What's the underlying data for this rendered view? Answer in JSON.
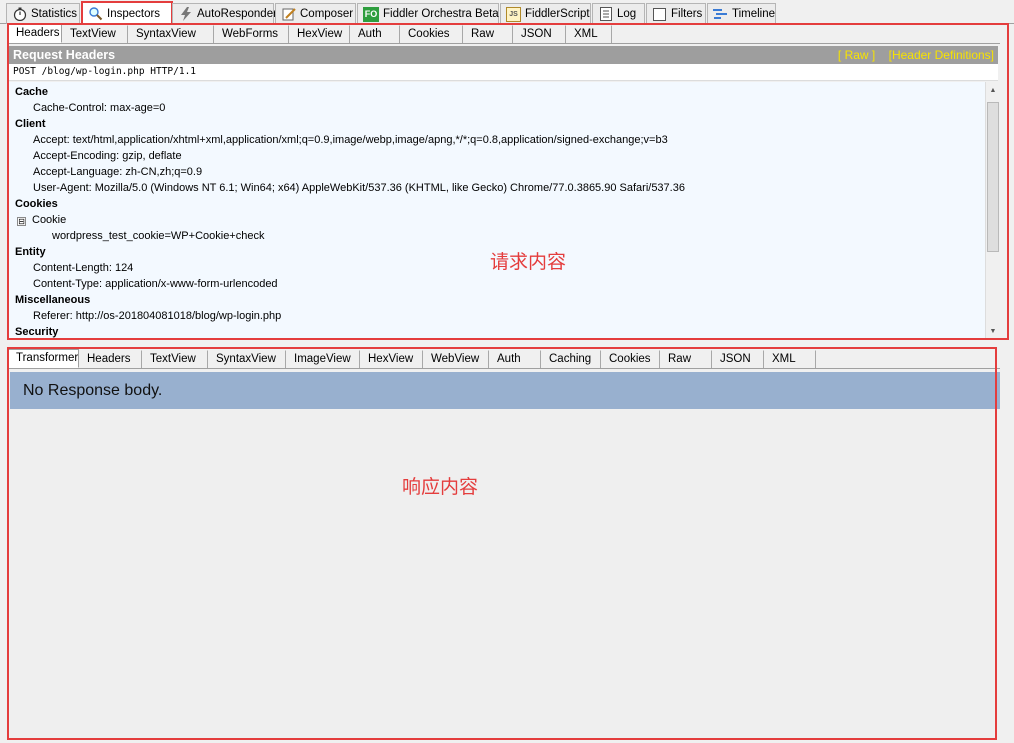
{
  "top_tabs": [
    {
      "label": "Statistics",
      "icon": "stopwatch-icon"
    },
    {
      "label": "Inspectors",
      "icon": "magnifier-icon",
      "active": true
    },
    {
      "label": "AutoResponder",
      "icon": "lightning-icon"
    },
    {
      "label": "Composer",
      "icon": "pencil-icon"
    },
    {
      "label": "Fiddler Orchestra Beta",
      "icon": "fo-icon",
      "icon_text": "FO"
    },
    {
      "label": "FiddlerScript",
      "icon": "script-icon",
      "icon_text": "JS"
    },
    {
      "label": "Log",
      "icon": "log-icon"
    },
    {
      "label": "Filters",
      "icon": "checkbox-icon"
    },
    {
      "label": "Timeline",
      "icon": "timeline-icon"
    }
  ],
  "request": {
    "tabs": [
      "Headers",
      "TextView",
      "SyntaxView",
      "WebForms",
      "HexView",
      "Auth",
      "Cookies",
      "Raw",
      "JSON",
      "XML"
    ],
    "title": "Request Headers",
    "raw_link": "[ Raw ]",
    "defs_link": "[Header Definitions]",
    "request_line": "POST /blog/wp-login.php HTTP/1.1",
    "tree": [
      {
        "group": "Cache",
        "items": [
          "Cache-Control: max-age=0"
        ]
      },
      {
        "group": "Client",
        "items": [
          "Accept: text/html,application/xhtml+xml,application/xml;q=0.9,image/webp,image/apng,*/*;q=0.8,application/signed-exchange;v=b3",
          "Accept-Encoding: gzip, deflate",
          "Accept-Language: zh-CN,zh;q=0.9",
          "User-Agent: Mozilla/5.0 (Windows NT 6.1; Win64; x64) AppleWebKit/537.36 (KHTML, like Gecko) Chrome/77.0.3865.90 Safari/537.36"
        ]
      },
      {
        "group": "Cookies",
        "cookie_label": "Cookie",
        "expander": "⊟",
        "cookie_value": "wordpress_test_cookie=WP+Cookie+check"
      },
      {
        "group": "Entity",
        "items": [
          "Content-Length: 124",
          "Content-Type: application/x-www-form-urlencoded"
        ]
      },
      {
        "group": "Miscellaneous",
        "items": [
          "Referer: http://os-201804081018/blog/wp-login.php"
        ]
      },
      {
        "group": "Security",
        "items": []
      }
    ],
    "annotation": "请求内容"
  },
  "response": {
    "tabs": [
      "Transformer",
      "Headers",
      "TextView",
      "SyntaxView",
      "ImageView",
      "HexView",
      "WebView",
      "Auth",
      "Caching",
      "Cookies",
      "Raw",
      "JSON",
      "XML"
    ],
    "message": "No Response body.",
    "annotation": "响应内容"
  },
  "colors": {
    "highlight": "#e43d3d",
    "header_bar": "#9e9e9e",
    "link_yellow": "#f7e300",
    "response_bar": "#98b0cf",
    "tree_bg": "#f3f9ff"
  }
}
